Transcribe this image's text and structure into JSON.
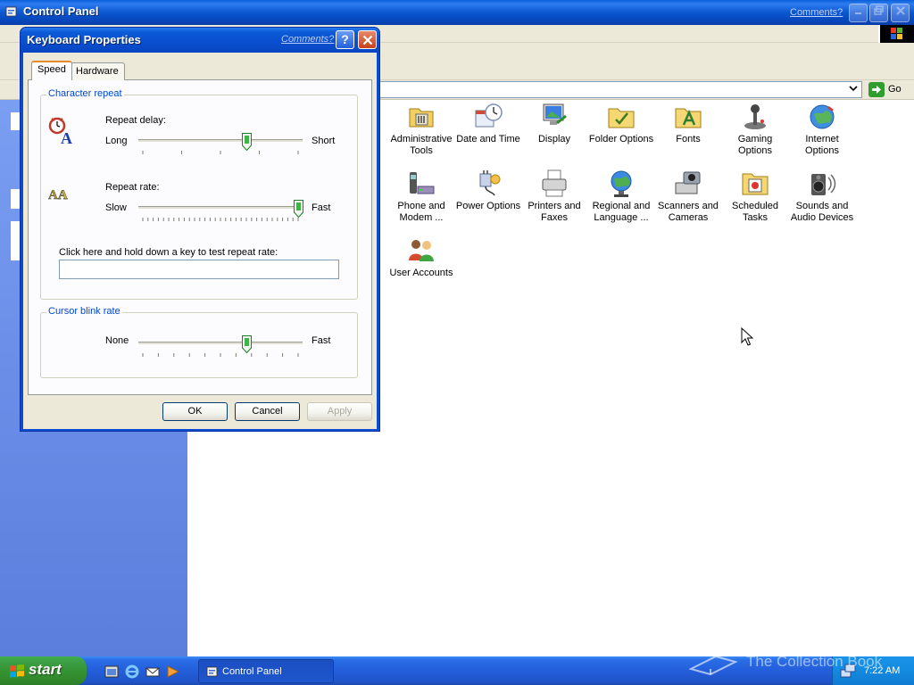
{
  "control_panel": {
    "title": "Control Panel",
    "comments_link": "Comments?",
    "address_go": "Go",
    "items": [
      {
        "label": "Administrative Tools"
      },
      {
        "label": "Date and Time"
      },
      {
        "label": "Display"
      },
      {
        "label": "Folder Options"
      },
      {
        "label": "Fonts"
      },
      {
        "label": "Gaming Options"
      },
      {
        "label": "Internet Options"
      },
      {
        "label": "Phone and Modem ..."
      },
      {
        "label": "Power Options"
      },
      {
        "label": "Printers and Faxes"
      },
      {
        "label": "Regional and Language ..."
      },
      {
        "label": "Scanners and Cameras"
      },
      {
        "label": "Scheduled Tasks"
      },
      {
        "label": "Sounds and Audio Devices"
      },
      {
        "label": "User Accounts"
      }
    ]
  },
  "dialog": {
    "title": "Keyboard Properties",
    "comments_link": "Comments?",
    "help_glyph": "?",
    "tabs": [
      {
        "label": "Speed",
        "selected": true
      },
      {
        "label": "Hardware",
        "selected": false
      }
    ],
    "character_repeat": {
      "legend": "Character repeat",
      "repeat_delay": {
        "label": "Repeat delay:",
        "min_label": "Long",
        "max_label": "Short",
        "value_fraction": 0.67
      },
      "repeat_rate": {
        "label": "Repeat rate:",
        "min_label": "Slow",
        "max_label": "Fast",
        "value_fraction": 1.0
      },
      "test_prompt": "Click here and hold down a key to test repeat rate:",
      "test_value": ""
    },
    "cursor_blink": {
      "legend": "Cursor blink rate",
      "min_label": "None",
      "max_label": "Fast",
      "value_fraction": 0.67
    },
    "buttons": {
      "ok": "OK",
      "cancel": "Cancel",
      "apply": "Apply"
    }
  },
  "taskbar": {
    "start_label": "start",
    "task_label": "Control Panel",
    "clock": "7:22 AM"
  },
  "watermark": "The Collection Book"
}
